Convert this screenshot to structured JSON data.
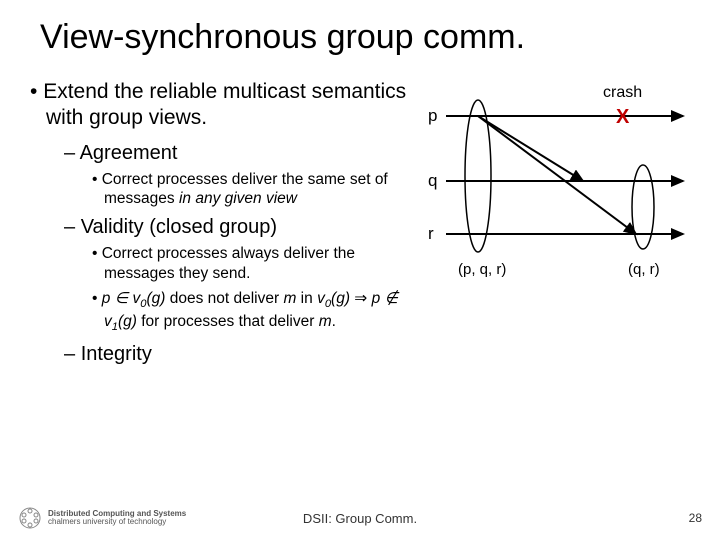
{
  "title": "View-synchronous group comm.",
  "bullets": {
    "main": "Extend the reliable multicast semantics with group views.",
    "agreement": "Agreement",
    "agreement_sub": "Correct processes deliver the same set of messages ",
    "agreement_sub_it": "in any given view",
    "validity": "Validity (closed group)",
    "validity_sub1": "Correct processes always deliver the messages they send.",
    "validity_sub2a": "p ∈ v",
    "validity_sub2b": "(g) does not deliver ",
    "validity_sub2c": " in v",
    "validity_sub2d": "(g) ⇒ p ∉ v",
    "validity_sub2e": "(g) for processes that deliver ",
    "validity_m": "m",
    "validity_zero": "0",
    "validity_one": "1",
    "validity_dot": ".",
    "integrity": "Integrity"
  },
  "diagram": {
    "crash_label": "crash",
    "x_label": "X",
    "p_label": "p",
    "q_label": "q",
    "r_label": "r",
    "view0": "(p, q, r)",
    "view1": "(q, r)"
  },
  "footer": {
    "dept1": "Distributed Computing and Systems",
    "dept2": "chalmers university of technology",
    "center": "DSII: Group Comm.",
    "page": "28"
  }
}
